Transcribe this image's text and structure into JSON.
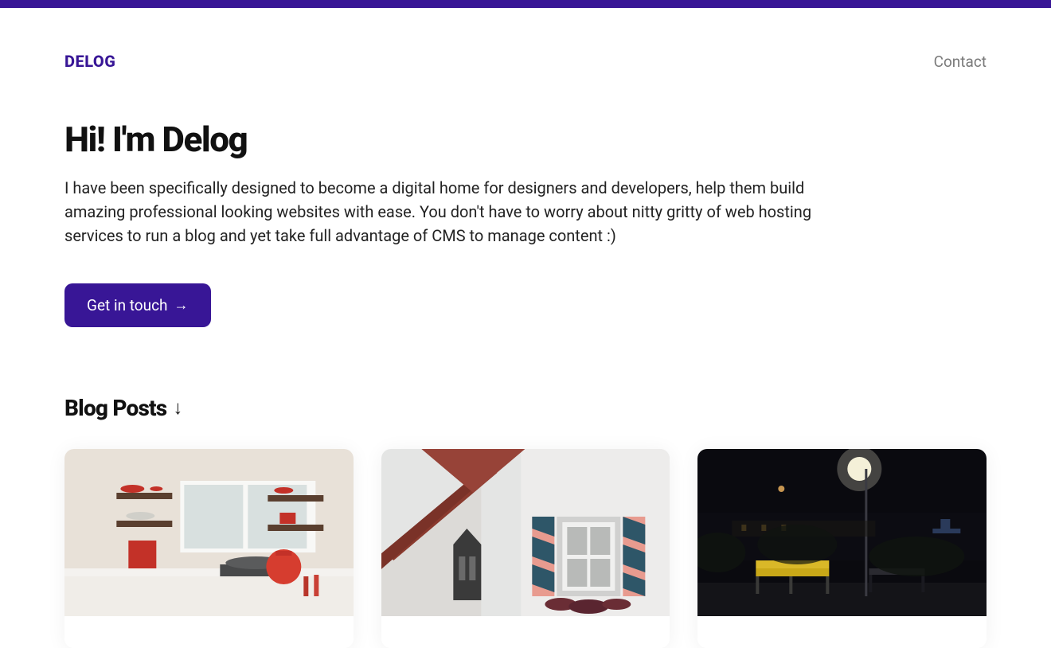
{
  "header": {
    "logo": "DELOG",
    "nav": {
      "contact": "Contact"
    }
  },
  "hero": {
    "title": "Hi! I'm Delog",
    "description": "I have been specifically designed to become a digital home for designers and developers, help them build amazing professional looking websites with ease. You don't have to worry about nitty gritty of web hosting services to run a blog and yet take full advantage of CMS to manage content :)",
    "cta_label": "Get in touch",
    "cta_arrow": "→"
  },
  "posts": {
    "heading": "Blog Posts",
    "heading_arrow": "↓",
    "items": [
      {
        "image_alt": "kitchen-interior"
      },
      {
        "image_alt": "building-window"
      },
      {
        "image_alt": "night-bench"
      }
    ]
  },
  "colors": {
    "brand": "#381696",
    "text": "#111111",
    "muted": "#7a7a7a"
  }
}
